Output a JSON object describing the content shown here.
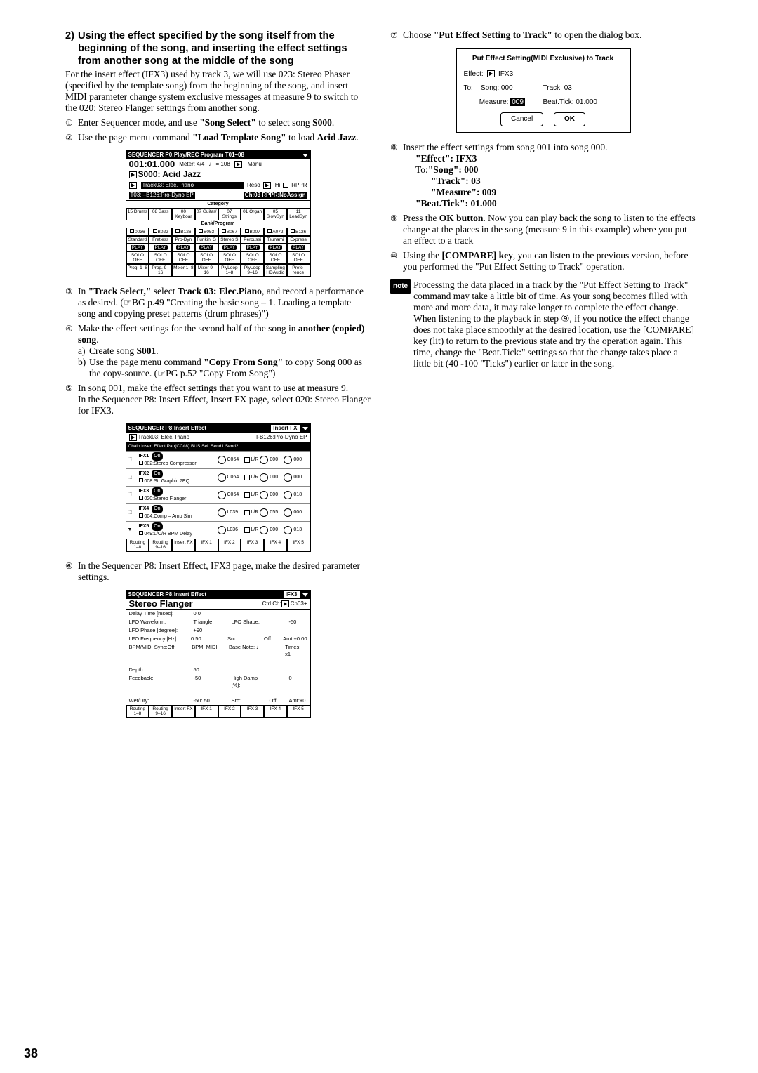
{
  "left": {
    "heading_num": "2)",
    "heading": "Using the effect specified by the song itself from the beginning of the song, and inserting the effect settings from another song at the middle of the song",
    "intro": "For the insert effect (IFX3) used by track 3, we will use 023: Stereo Phaser (specified by the template song) from the beginning of the song, and insert MIDI parameter change system exclusive messages at measure 9 to switch to the 020: Stereo Flanger settings from another song.",
    "steps": [
      {
        "marker": "①",
        "body_pre": "Enter Sequencer mode, and use ",
        "bold": "\"Song Select\"",
        "body_post": " to select song ",
        "bold2": "S000",
        "tail": "."
      },
      {
        "marker": "②",
        "body_pre": "Use the page menu command ",
        "bold": "\"Load Template Song\"",
        "body_post": " to load ",
        "bold2": "Acid Jazz",
        "tail": "."
      }
    ],
    "step3": {
      "marker": "③",
      "body": "In \"Track Select,\" select Track 03: Elec.Piano, and record a performance as desired. (☞BG p.49 \"Creating the basic song – 1. Loading a template song and copying preset patterns (drum phrases)\")"
    },
    "step4": {
      "marker": "④",
      "lead": "Make the effect settings for the second half of the song in another (copied) song.",
      "a": "Create song S001.",
      "b": "Use the page menu command \"Copy From Song\" to copy Song 000 as the copy-source. (☞PG p.52 \"Copy From Song\")"
    },
    "step5": {
      "marker": "⑤",
      "lead": "In song 001, make the effect settings that you want to use at measure 9.",
      "sub": "In the Sequencer P8: Insert Effect, Insert FX page, select 020: Stereo Flanger for IFX3."
    },
    "step6": {
      "marker": "⑥",
      "body": "In the Sequencer P8: Insert Effect, IFX3 page, make the desired parameter settings."
    },
    "scr1": {
      "bar": "SEQUENCER P0:Play/REC   Program T01–08",
      "bigtime": "001:01.000",
      "meter": "Meter: 4/4",
      "tempo": "♩ = 108",
      "manu": "Manu",
      "songname": "S000: Acid Jazz",
      "track": "Track03: Elec. Piano",
      "reso": "Reso",
      "hi": "Hi",
      "rppr": "RPPR",
      "trackinfo": "T03:I–B126:Pro-Dyno EP",
      "ch": "Ch:03",
      "rpprno": "RPPR:NoAssign",
      "catlabel": "Category",
      "cats": [
        "15 Drums",
        "08 Bass",
        "00 Keyboar",
        "07 Guitar/",
        "07 Strings",
        "01 Organ",
        "05 SlowSyn",
        "11 LeadSyn"
      ],
      "banklabel": "Bank/Program",
      "banks": [
        "0036",
        "B022",
        "B126",
        "B053",
        "B067",
        "B007",
        "A072",
        "B126"
      ],
      "names": [
        "Standard",
        "Fretless",
        "Pro-Dyn",
        "Funkin' G",
        "Stereo S",
        "Percussi",
        "Tsunami",
        "Express"
      ],
      "play": "PLAY",
      "solo": "SOLO OFF",
      "tabs": [
        "Prog. 1–8",
        "Prog. 9–16",
        "Mixer 1–8",
        "Mixer 9–16",
        "PlyLoop 1–8",
        "PlyLoop 9–16",
        "Sampling HDAudio",
        "Prefe- rence"
      ]
    },
    "scr2": {
      "bar": "SEQUENCER P8:Insert Effect",
      "right": "Insert FX",
      "track": "Track03: Elec. Piano",
      "trackprog": "I-B126:Pro-Dyno EP",
      "cols": "Chain      Insert Effect         Pan(CC#8) BUS Sel.  Send1 Send2",
      "ifx": [
        {
          "n": "IFX1",
          "prog": "002:Stereo Compressor",
          "c": "C064",
          "s1": "000",
          "s2": "000"
        },
        {
          "n": "IFX2",
          "prog": "008:St. Graphic 7EQ",
          "c": "C064",
          "s1": "000",
          "s2": "000"
        },
        {
          "n": "IFX3",
          "prog": "020:Stereo Flanger",
          "c": "C064",
          "s1": "000",
          "s2": "018"
        },
        {
          "n": "IFX4",
          "prog": "004:Comp – Amp Sim",
          "c": "L039",
          "s1": "055",
          "s2": "000"
        },
        {
          "n": "IFX5",
          "prog": "049:L/C/R BPM Delay",
          "c": "L036",
          "s1": "000",
          "s2": "013"
        }
      ],
      "on": "On",
      "lr": "L/R",
      "tabs": [
        "Routing 1–8",
        "Routing 9–16",
        "Insert FX",
        "IFX 1",
        "IFX 2",
        "IFX 3",
        "IFX 4",
        "IFX 5"
      ]
    },
    "scr3": {
      "bar": "SEQUENCER P8:Insert Effect",
      "right": "IFX3",
      "title": "Stereo Flanger",
      "ctrl": "Ctrl Ch:",
      "ctrlval": "Ch03+",
      "rows": [
        [
          "Delay Time [msec]:",
          "0.0",
          "",
          "",
          ""
        ],
        [
          "LFO Waveform:",
          "Triangle",
          "LFO Shape:",
          "",
          "-50"
        ],
        [
          "LFO Phase [degree]:",
          "+90",
          "",
          "",
          ""
        ],
        [
          "LFO Frequency [Hz]:",
          "0.50",
          "Src:",
          "Off",
          "Amt:+0.00"
        ],
        [
          "BPM/MIDI Sync:Off",
          "BPM: MIDI",
          "Base Note: ♩",
          "",
          "Times: x1"
        ],
        [
          "",
          "",
          "",
          "",
          ""
        ],
        [
          "Depth:",
          "50",
          "",
          "",
          ""
        ],
        [
          "Feedback:",
          "-50",
          "High Damp [%]:",
          "",
          "0"
        ],
        [
          "",
          "",
          "",
          "",
          ""
        ],
        [
          "Wet/Dry:",
          "-50: 50",
          "Src:",
          "Off",
          "Amt:+0"
        ]
      ],
      "tabs": [
        "Routing 1–8",
        "Routing 9–16",
        "Insert FX",
        "IFX 1",
        "IFX 2",
        "IFX 3",
        "IFX 4",
        "IFX 5"
      ]
    }
  },
  "right": {
    "step7": {
      "marker": "⑦",
      "body_pre": "Choose ",
      "bold": "\"Put Effect Setting to Track\"",
      "body_post": " to open the dialog box."
    },
    "dlg": {
      "title": "Put Effect Setting(MIDI Exclusive) to Track",
      "effectlbl": "Effect:",
      "effectval": "IFX3",
      "tolbl": "To:",
      "songlbl": "Song:",
      "songval": "000",
      "tracklbl": "Track:",
      "trackval": "03",
      "measlbl": "Measure:",
      "measval": "009",
      "beatlbl": "Beat.Tick:",
      "beatval": "01.000",
      "cancel": "Cancel",
      "ok": "OK"
    },
    "step8": {
      "marker": "⑧",
      "lead": "Insert the effect settings from song 001 into song 000.",
      "lines": [
        "\"Effect\": IFX3",
        "To:\"Song\": 000",
        "\"Track\": 03",
        "\"Measure\": 009",
        "\"Beat.Tick\": 01.000"
      ],
      "indent": [
        0,
        0,
        1,
        1,
        0
      ]
    },
    "step9": {
      "marker": "⑨",
      "body": "Press the OK button. Now you can play back the song to listen to the effects change at the places in the song (measure 9 in this example) where you put an effect to a track"
    },
    "step10": {
      "marker": "⑩",
      "body": "Using the [COMPARE] key, you can listen to the previous version, before you performed the \"Put Effect Setting to Track\" operation."
    },
    "note": "Processing the data placed in a track by the \"Put Effect Setting to Track\" command may take a little bit of time. As your song becomes filled with more and more data, it may take longer to complete the effect change. When listening to the playback in step ⑨, if you notice the effect change does not take place smoothly at the desired location, use the [COMPARE] key (lit) to return to the previous state and try the operation again. This time, change the \"Beat.Tick:\" settings so that the change takes place a little bit (40 -100 \"Ticks\") earlier or later in the song.",
    "notelabel": "note"
  },
  "pagenum": "38"
}
